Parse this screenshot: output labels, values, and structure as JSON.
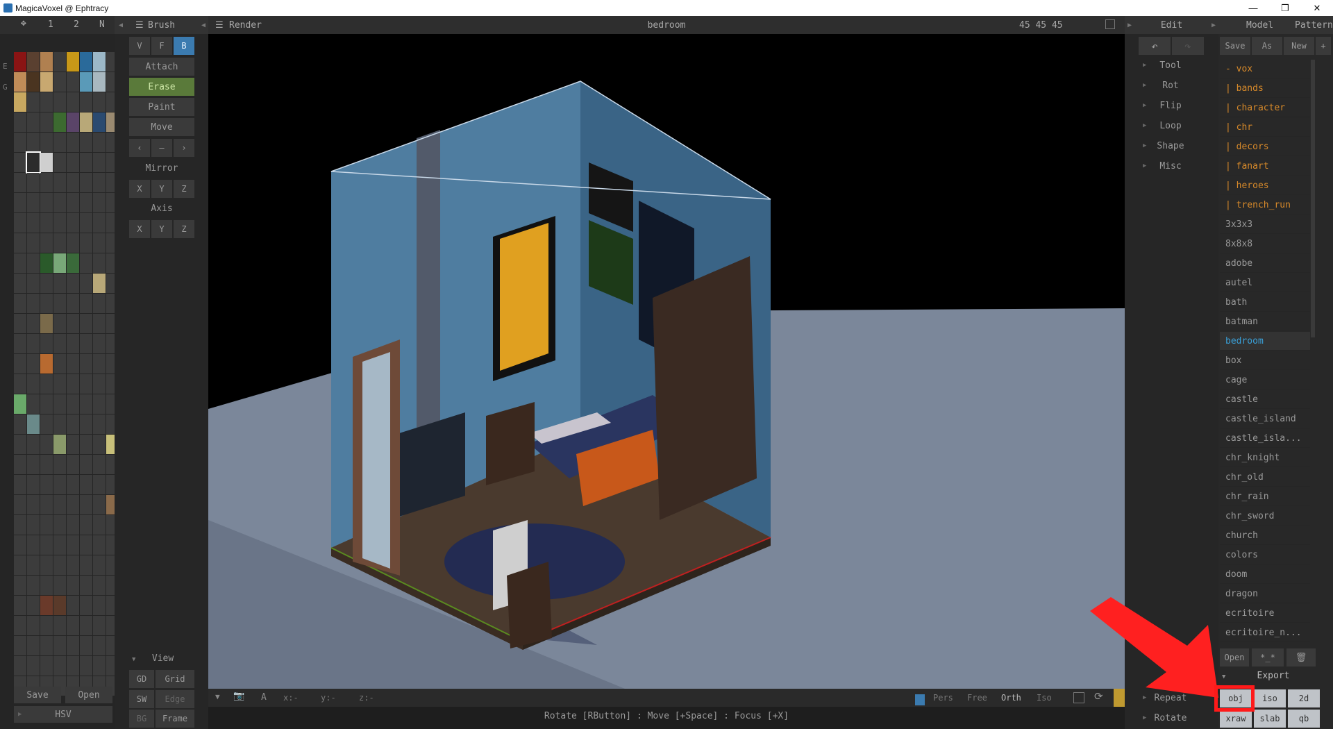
{
  "window": {
    "title": "MagicaVoxel @ Ephtracy"
  },
  "palette_tabs": [
    "1",
    "2",
    "N"
  ],
  "palette_side": [
    "E",
    "G"
  ],
  "palette_buttons": {
    "save": "Save",
    "open": "Open",
    "hsv": "HSV"
  },
  "brush": {
    "title": "Brush",
    "modes": [
      "V",
      "F",
      "B"
    ],
    "actions": [
      "Attach",
      "Erase",
      "Paint",
      "Move"
    ],
    "arrows": [
      "‹",
      "–",
      "›"
    ],
    "mirror": "Mirror",
    "axis": "Axis",
    "xyz": [
      "X",
      "Y",
      "Z"
    ],
    "view": "View",
    "view_buttons": [
      [
        "GD",
        "Grid"
      ],
      [
        "SW",
        "Edge"
      ],
      [
        "BG",
        "Frame"
      ]
    ]
  },
  "render": {
    "title": "Render",
    "scene_name": "bedroom",
    "dims": "45 45 45"
  },
  "viewport_bottom": {
    "a": "A",
    "x": "x:-",
    "y": "y:-",
    "z": "z:-",
    "modes": [
      "Pers",
      "Free",
      "Orth",
      "Iso"
    ]
  },
  "status": "Rotate [RButton] : Move [+Space] : Focus [+X]",
  "edit": {
    "title": "Edit",
    "menu": [
      "Tool",
      "Rot",
      "Flip",
      "Loop",
      "Shape",
      "Misc"
    ],
    "bottom": [
      "Repeat",
      "Rotate"
    ]
  },
  "right_tabs": [
    "Model",
    "Pattern"
  ],
  "file_buttons": [
    "Save",
    "As",
    "New",
    "+"
  ],
  "files": {
    "folder": "- vox",
    "subfolders": [
      "| bands",
      "| character",
      "| chr",
      "| decors",
      "| fanart",
      "| heroes",
      "| trench_run"
    ],
    "items": [
      "3x3x3",
      "8x8x8",
      "adobe",
      "autel",
      "bath",
      "batman",
      "bedroom",
      "box",
      "cage",
      "castle",
      "castle_island",
      "castle_isla...",
      "chr_knight",
      "chr_old",
      "chr_rain",
      "chr_sword",
      "church",
      "colors",
      "doom",
      "dragon",
      "ecritoire",
      "ecritoire_n..."
    ],
    "selected": "bedroom"
  },
  "list_footer": {
    "open": "Open",
    "pattern": "*_*"
  },
  "export": {
    "title": "Export",
    "row1": [
      "obj",
      "iso",
      "2d"
    ],
    "row2": [
      "xraw",
      "slab",
      "qb"
    ]
  },
  "colors": {
    "accent_blue": "#3b7bb0",
    "erase_green": "#5a7a3a",
    "annotation_red": "#ff2020",
    "folder_orange": "#d88a2a"
  }
}
